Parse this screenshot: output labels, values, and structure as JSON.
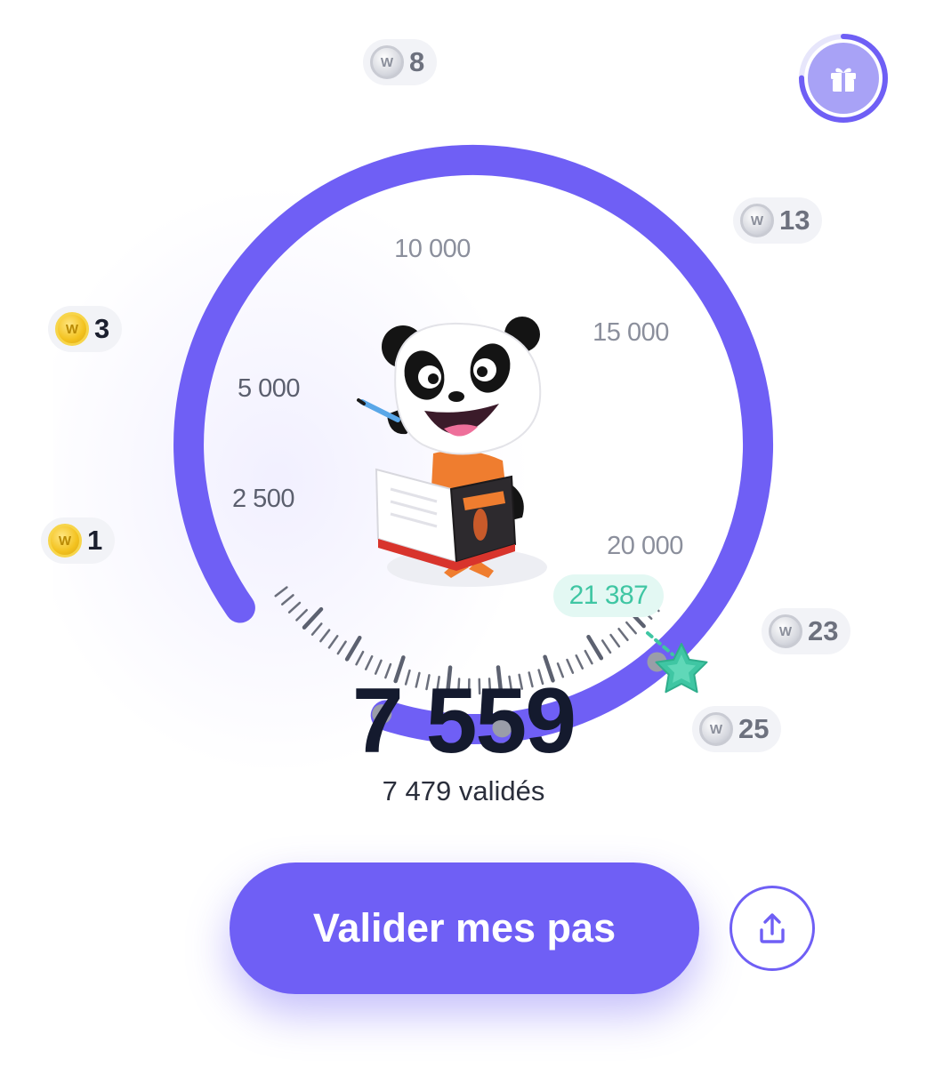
{
  "gauge": {
    "current_steps": 7559,
    "goal_steps": 21387,
    "scale_labels": [
      "2 500",
      "5 000",
      "10 000",
      "15 000",
      "20 000"
    ],
    "goal_label": "21 387"
  },
  "rewards": [
    {
      "coins": "1",
      "state": "earned"
    },
    {
      "coins": "3",
      "state": "earned"
    },
    {
      "coins": "8",
      "state": "locked"
    },
    {
      "coins": "13",
      "state": "locked"
    },
    {
      "coins": "23",
      "state": "locked"
    },
    {
      "coins": "25",
      "state": "locked"
    }
  ],
  "coin_icon_letter": "W",
  "summary": {
    "total": "7 559",
    "validated": "7 479 validés"
  },
  "actions": {
    "validate_label": "Valider mes pas"
  },
  "colors": {
    "accent": "#6f5ff5",
    "track": "#eff1f7",
    "goal": "#3fc6a3",
    "coin_gold": "#f3c21f",
    "coin_grey": "#c9cbd3"
  },
  "icons": {
    "gift": "gift-icon",
    "share": "share-icon",
    "goal": "star-icon",
    "mascot": "panda-illustration"
  },
  "gift_progress": 0.75
}
